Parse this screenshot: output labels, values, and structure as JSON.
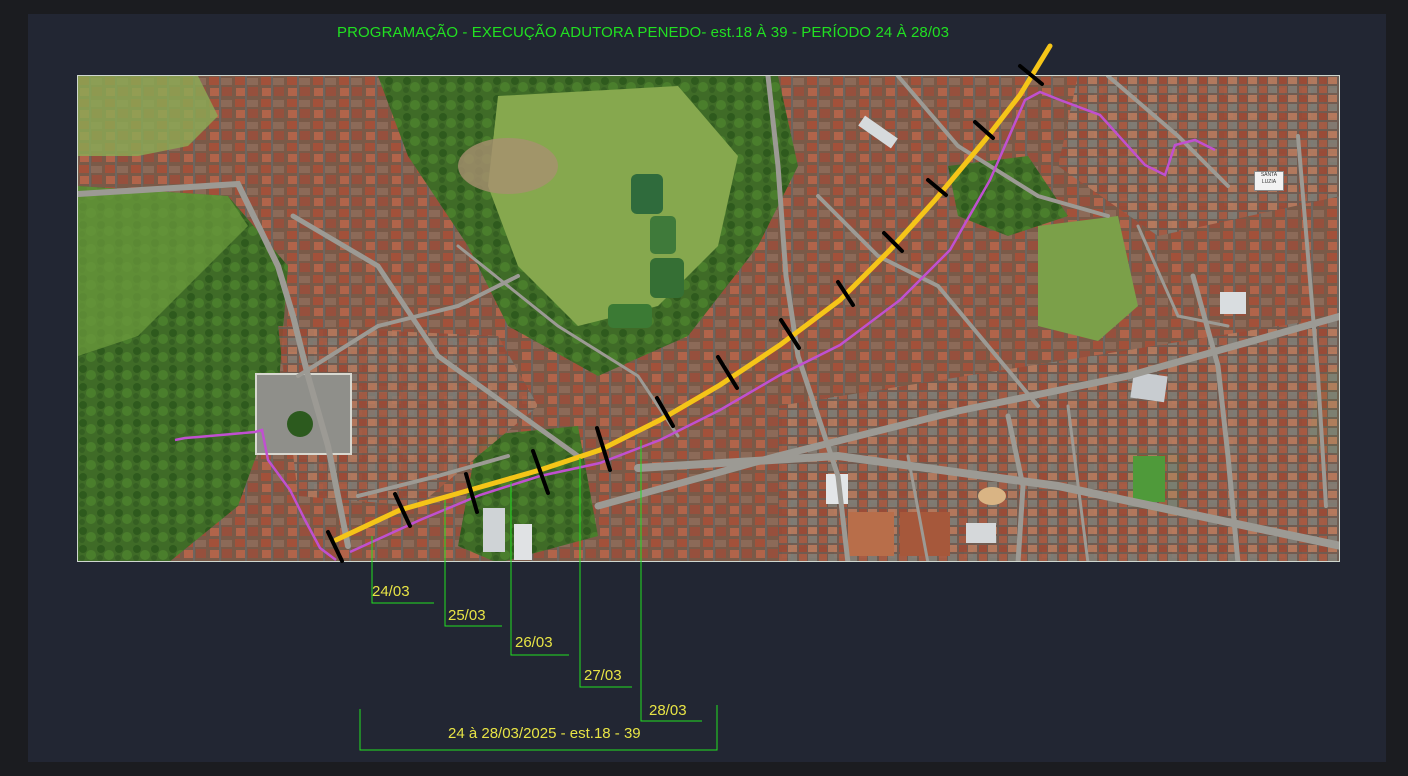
{
  "title": "PROGRAMAÇÃO - EXECUÇÃO ADUTORA PENEDO- est.18 À 39 - PERÍODO 24 À 28/03",
  "schedule": [
    {
      "date": "24/03"
    },
    {
      "date": "25/03"
    },
    {
      "date": "26/03"
    },
    {
      "date": "27/03"
    },
    {
      "date": "28/03"
    }
  ],
  "summary": "24 à 28/03/2025 - est.18 - 39",
  "map_place_label": "SANTA LUZIA",
  "colors": {
    "pipeline_planned": "#f5c518",
    "pipeline_existing": "#c050d0",
    "station_marks": "#000000",
    "leader_lines": "#21e021",
    "label_text": "#e8e445",
    "title_text": "#21e021",
    "background": "#222633"
  },
  "icons": {
    "station_mark": "black-tick",
    "pipeline": "yellow-line"
  }
}
